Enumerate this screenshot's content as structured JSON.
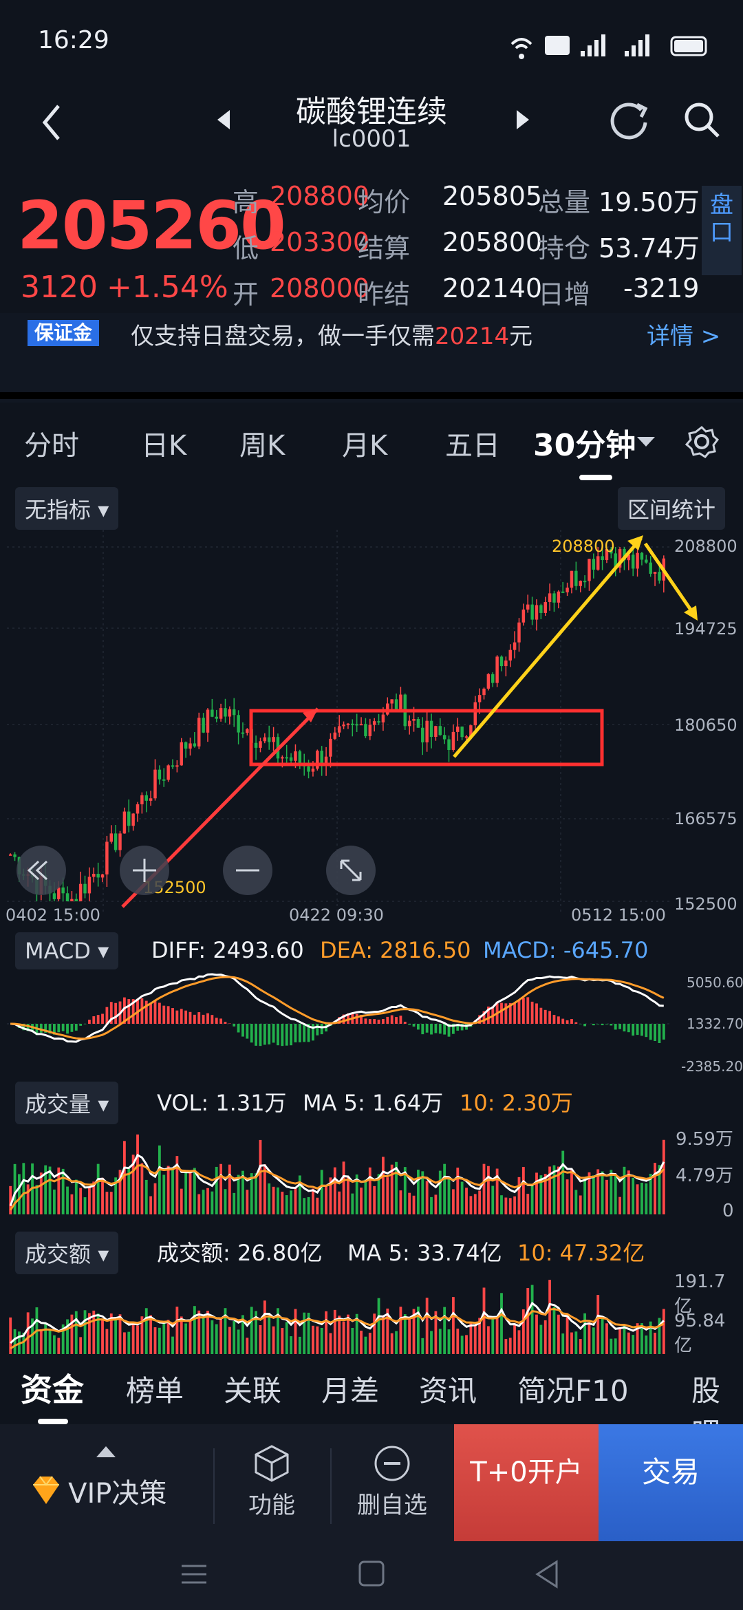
{
  "status": {
    "time": "16:29"
  },
  "header": {
    "title": "碳酸锂连续",
    "code": "lc0001"
  },
  "quote": {
    "price": "205260",
    "change": "3120",
    "pct": "+1.54%",
    "high_label": "高",
    "high": "208800",
    "low_label": "低",
    "low": "203300",
    "open_label": "开",
    "open": "208000",
    "avg_label": "均价",
    "avg": "205805",
    "settle_label": "结算",
    "settle": "205800",
    "prev_label": "昨结",
    "prev": "202140",
    "vol_label": "总量",
    "vol": "19.50万",
    "oi_label": "持仓",
    "oi": "53.74万",
    "inc_label": "日增",
    "inc": "-3219",
    "panel_label": "盘口"
  },
  "notice": {
    "tag": "保证金",
    "text_a": "仅支持日盘交易，做一手仅需",
    "amount": "20214",
    "text_b": "元",
    "detail": "详情 >"
  },
  "tabs": [
    "分时",
    "日K",
    "周K",
    "月K",
    "五日",
    "30分钟"
  ],
  "indicator": {
    "label": "无指标",
    "stats": "区间统计"
  },
  "kline": {
    "y_labels": [
      "208800",
      "194725",
      "180650",
      "166575",
      "152500"
    ],
    "x_labels": [
      "0402 15:00",
      "0422 09:30",
      "0512 15:00"
    ],
    "high_mark": "208800",
    "low_mark": "152500"
  },
  "macd": {
    "label": "MACD",
    "diff": "DIFF: 2493.60",
    "dea": "DEA: 2816.50",
    "macd": "MACD: -645.70",
    "ticks": [
      "5050.60",
      "1332.70",
      "-2385.20"
    ]
  },
  "volume": {
    "label": "成交量",
    "vol": "VOL: 1.31万",
    "ma5": "MA 5: 1.64万",
    "ma10": "10: 2.30万",
    "ticks": [
      "9.59万",
      "4.79万",
      "0"
    ]
  },
  "amount": {
    "label": "成交额",
    "amt": "成交额: 26.80亿",
    "ma5": "MA 5: 33.74亿",
    "ma10": "10: 47.32亿",
    "ticks": [
      "191.7亿",
      "95.84亿"
    ]
  },
  "bottom_tabs": [
    "资金",
    "榜单",
    "关联",
    "月差",
    "资讯",
    "简况F10",
    "股吧"
  ],
  "actions": {
    "vip": "VIP决策",
    "func": "功能",
    "del": "删自选",
    "open": "T+0开户",
    "trade": "交易"
  },
  "chart_data": {
    "type": "candlestick",
    "title": "碳酸锂连续 lc0001 30分钟",
    "xlabel": "",
    "ylabel": "",
    "ylim": [
      152500,
      208800
    ],
    "x_ticks": [
      "0402 15:00",
      "0422 09:30",
      "0512 15:00"
    ],
    "close_path": [
      160000,
      155000,
      152500,
      158000,
      166000,
      172000,
      178000,
      183000,
      180000,
      176000,
      174000,
      178000,
      181000,
      184000,
      179000,
      178000,
      186000,
      196000,
      201000,
      204000,
      208800,
      206000,
      205260
    ],
    "annotations": [
      "208800",
      "152500"
    ]
  },
  "colors": {
    "up": "#ff4747",
    "down": "#22b14c",
    "bg": "#0f141d",
    "accent": "#ffd21a"
  }
}
